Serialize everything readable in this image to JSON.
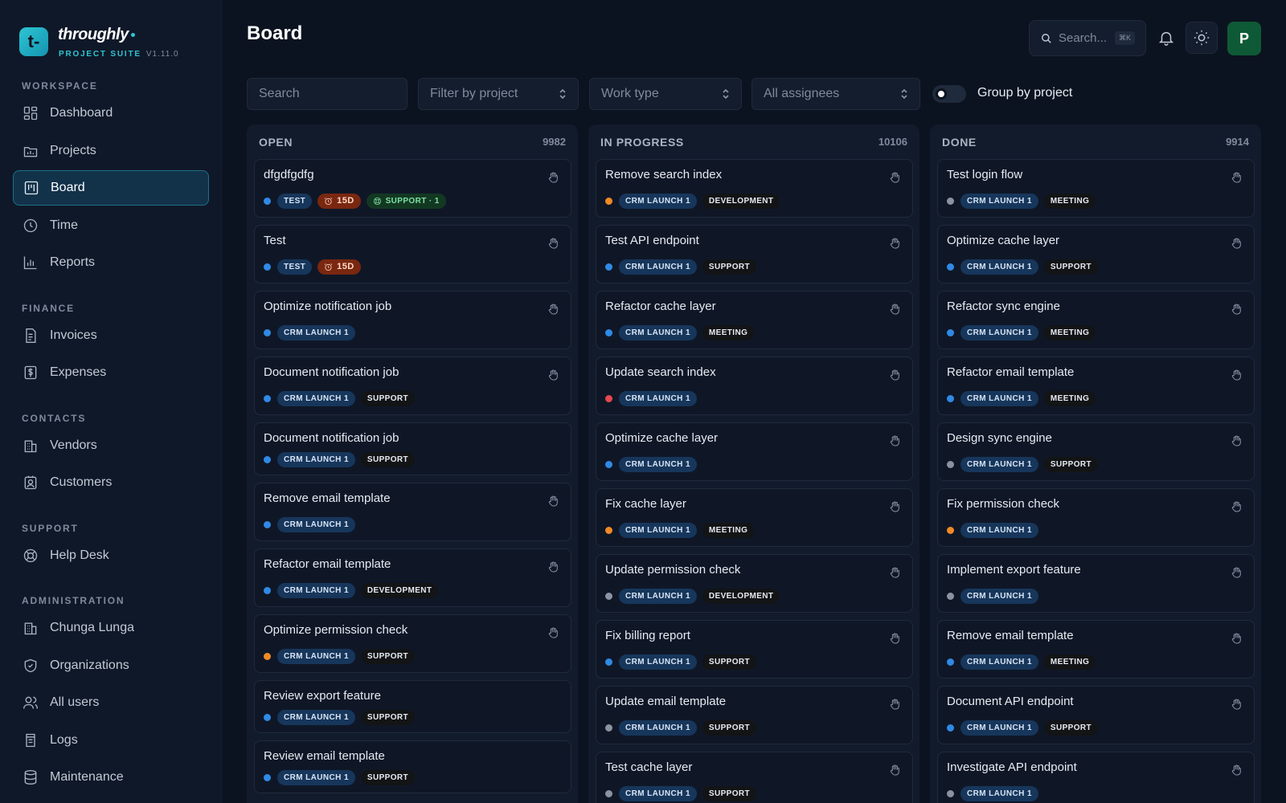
{
  "brand": {
    "logo_glyph": "t-",
    "name": "throughly",
    "suite": "PROJECT SUITE",
    "version": "V1.11.0"
  },
  "sidebar": {
    "sections": [
      {
        "title": "WORKSPACE",
        "items": [
          {
            "label": "Dashboard",
            "icon": "dashboard-icon"
          },
          {
            "label": "Projects",
            "icon": "projects-icon"
          },
          {
            "label": "Board",
            "icon": "board-icon",
            "active": true
          },
          {
            "label": "Time",
            "icon": "clock-icon"
          },
          {
            "label": "Reports",
            "icon": "bar-chart-icon"
          }
        ]
      },
      {
        "title": "FINANCE",
        "items": [
          {
            "label": "Invoices",
            "icon": "invoice-icon"
          },
          {
            "label": "Expenses",
            "icon": "dollar-icon"
          }
        ]
      },
      {
        "title": "CONTACTS",
        "items": [
          {
            "label": "Vendors",
            "icon": "building-icon"
          },
          {
            "label": "Customers",
            "icon": "customer-icon"
          }
        ]
      },
      {
        "title": "SUPPORT",
        "items": [
          {
            "label": "Help Desk",
            "icon": "lifebuoy-icon"
          }
        ]
      },
      {
        "title": "ADMINISTRATION",
        "items": [
          {
            "label": "Chunga Lunga",
            "icon": "building-icon"
          },
          {
            "label": "Organizations",
            "icon": "shield-icon"
          },
          {
            "label": "All users",
            "icon": "users-icon"
          },
          {
            "label": "Logs",
            "icon": "logs-icon"
          },
          {
            "label": "Maintenance",
            "icon": "database-icon"
          }
        ]
      }
    ]
  },
  "header": {
    "title": "Board",
    "search_placeholder": "Search...",
    "search_shortcut": "⌘K",
    "avatar_initial": "P"
  },
  "filters": {
    "search_placeholder": "Search",
    "project_placeholder": "Filter by project",
    "worktype_placeholder": "Work type",
    "assignee_placeholder": "All assignees",
    "group_by_label": "Group by project",
    "group_by_on": false
  },
  "colors": {
    "blue": "#2f8ae6",
    "orange": "#f08a24",
    "red": "#e5484d",
    "gray": "#8b93a1"
  },
  "columns": [
    {
      "title": "OPEN",
      "count": "9982",
      "cards": [
        {
          "title": "dfgdfgdfg",
          "dot": "blue",
          "project": "TEST",
          "due": "15D",
          "support": "SUPPORT · 1"
        },
        {
          "title": "Test",
          "dot": "blue",
          "project": "TEST",
          "due": "15D"
        },
        {
          "title": "Optimize notification job",
          "dot": "blue",
          "project": "CRM LAUNCH 1"
        },
        {
          "title": "Document notification job",
          "dot": "blue",
          "project": "CRM LAUNCH 1",
          "work": "SUPPORT"
        },
        {
          "title": "Document notification job",
          "dot": "blue",
          "project": "CRM LAUNCH 1",
          "work": "SUPPORT",
          "compact": true,
          "no_drag": true
        },
        {
          "title": "Remove email template",
          "dot": "blue",
          "project": "CRM LAUNCH 1"
        },
        {
          "title": "Refactor email template",
          "dot": "blue",
          "project": "CRM LAUNCH 1",
          "work": "DEVELOPMENT"
        },
        {
          "title": "Optimize permission check",
          "dot": "orange",
          "project": "CRM LAUNCH 1",
          "work": "SUPPORT"
        },
        {
          "title": "Review export feature",
          "dot": "blue",
          "project": "CRM LAUNCH 1",
          "work": "SUPPORT",
          "compact": true,
          "no_drag": true
        },
        {
          "title": "Review email template",
          "dot": "blue",
          "project": "CRM LAUNCH 1",
          "work": "SUPPORT",
          "compact": true,
          "no_drag": true
        }
      ]
    },
    {
      "title": "IN PROGRESS",
      "count": "10106",
      "cards": [
        {
          "title": "Remove search index",
          "dot": "orange",
          "project": "CRM LAUNCH 1",
          "work": "DEVELOPMENT"
        },
        {
          "title": "Test API endpoint",
          "dot": "blue",
          "project": "CRM LAUNCH 1",
          "work": "SUPPORT"
        },
        {
          "title": "Refactor cache layer",
          "dot": "blue",
          "project": "CRM LAUNCH 1",
          "work": "MEETING"
        },
        {
          "title": "Update search index",
          "dot": "red",
          "project": "CRM LAUNCH 1"
        },
        {
          "title": "Optimize cache layer",
          "dot": "blue",
          "project": "CRM LAUNCH 1"
        },
        {
          "title": "Fix cache layer",
          "dot": "orange",
          "project": "CRM LAUNCH 1",
          "work": "MEETING"
        },
        {
          "title": "Update permission check",
          "dot": "gray",
          "project": "CRM LAUNCH 1",
          "work": "DEVELOPMENT"
        },
        {
          "title": "Fix billing report",
          "dot": "blue",
          "project": "CRM LAUNCH 1",
          "work": "SUPPORT"
        },
        {
          "title": "Update email template",
          "dot": "gray",
          "project": "CRM LAUNCH 1",
          "work": "SUPPORT"
        },
        {
          "title": "Test cache layer",
          "dot": "gray",
          "project": "CRM LAUNCH 1",
          "work": "SUPPORT"
        }
      ]
    },
    {
      "title": "DONE",
      "count": "9914",
      "cards": [
        {
          "title": "Test login flow",
          "dot": "gray",
          "project": "CRM LAUNCH 1",
          "work": "MEETING"
        },
        {
          "title": "Optimize cache layer",
          "dot": "blue",
          "project": "CRM LAUNCH 1",
          "work": "SUPPORT"
        },
        {
          "title": "Refactor sync engine",
          "dot": "blue",
          "project": "CRM LAUNCH 1",
          "work": "MEETING"
        },
        {
          "title": "Refactor email template",
          "dot": "blue",
          "project": "CRM LAUNCH 1",
          "work": "MEETING"
        },
        {
          "title": "Design sync engine",
          "dot": "gray",
          "project": "CRM LAUNCH 1",
          "work": "SUPPORT"
        },
        {
          "title": "Fix permission check",
          "dot": "orange",
          "project": "CRM LAUNCH 1"
        },
        {
          "title": "Implement export feature",
          "dot": "gray",
          "project": "CRM LAUNCH 1"
        },
        {
          "title": "Remove email template",
          "dot": "blue",
          "project": "CRM LAUNCH 1",
          "work": "MEETING"
        },
        {
          "title": "Document API endpoint",
          "dot": "blue",
          "project": "CRM LAUNCH 1",
          "work": "SUPPORT"
        },
        {
          "title": "Investigate API endpoint",
          "dot": "gray",
          "project": "CRM LAUNCH 1"
        }
      ]
    }
  ]
}
